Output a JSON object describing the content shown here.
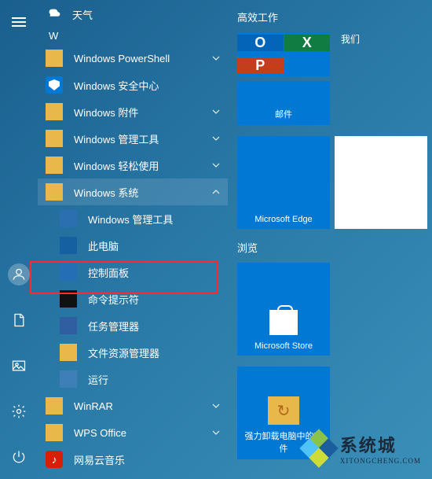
{
  "leftbar": {
    "hamburger": "menu",
    "account": "account",
    "documents": "documents",
    "pictures": "pictures",
    "settings": "settings",
    "power": "power"
  },
  "weather": {
    "label": "天气"
  },
  "section_letter": "W",
  "apps": [
    {
      "label": "Windows PowerShell",
      "expandable": true
    },
    {
      "label": "Windows 安全中心",
      "icon": "shield"
    },
    {
      "label": "Windows 附件",
      "expandable": true
    },
    {
      "label": "Windows 管理工具",
      "expandable": true
    },
    {
      "label": "Windows 轻松使用",
      "expandable": true
    },
    {
      "label": "Windows 系统",
      "expandable": true,
      "expanded": true
    }
  ],
  "subitems": [
    {
      "label": "Windows 管理工具",
      "icon": "tools"
    },
    {
      "label": "此电脑",
      "icon": "pc"
    },
    {
      "label": "控制面板",
      "icon": "cp"
    },
    {
      "label": "命令提示符",
      "icon": "cmd"
    },
    {
      "label": "任务管理器",
      "icon": "task"
    },
    {
      "label": "文件资源管理器",
      "icon": "file"
    },
    {
      "label": "运行",
      "icon": "run"
    }
  ],
  "apps_after": [
    {
      "label": "WinRAR",
      "expandable": true
    },
    {
      "label": "WPS Office",
      "expandable": true
    },
    {
      "label": "网易云音乐",
      "icon": "netease"
    }
  ],
  "tiles": {
    "group1_label": "高效工作",
    "office_apps": {
      "o": "O",
      "x": "X",
      "p": "P"
    },
    "we_label": "我们",
    "mail_label": "邮件",
    "edge_label": "Microsoft Edge",
    "group2_label": "浏览",
    "store_label": "Microsoft Store",
    "uninstall_label": "强力卸载电脑中的软件"
  },
  "watermark": {
    "big": "系统城",
    "small": "XITONGCHENG.COM"
  }
}
